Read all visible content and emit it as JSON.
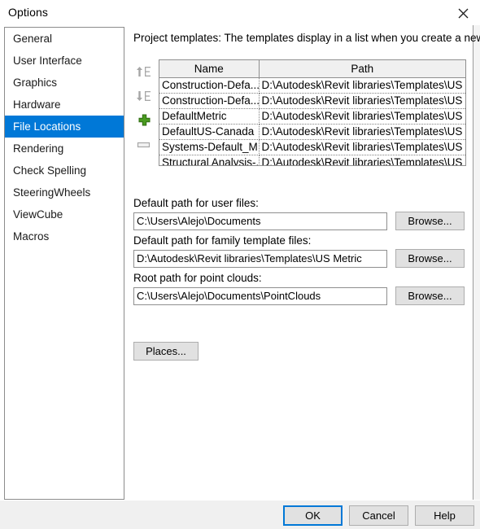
{
  "window": {
    "title": "Options",
    "close_icon": "close-icon"
  },
  "accent_color": "#0078d7",
  "sidebar": {
    "items": [
      {
        "label": "General",
        "selected": false
      },
      {
        "label": "User Interface",
        "selected": false
      },
      {
        "label": "Graphics",
        "selected": false
      },
      {
        "label": "Hardware",
        "selected": false
      },
      {
        "label": "File Locations",
        "selected": true
      },
      {
        "label": "Rendering",
        "selected": false
      },
      {
        "label": "Check Spelling",
        "selected": false
      },
      {
        "label": "SteeringWheels",
        "selected": false
      },
      {
        "label": "ViewCube",
        "selected": false
      },
      {
        "label": "Macros",
        "selected": false
      }
    ]
  },
  "content": {
    "templates_label": "Project templates:  The templates display in a list when you create a new project.",
    "list_toolbar": [
      {
        "name": "move-up-icon",
        "tooltip": "Move Up"
      },
      {
        "name": "move-down-icon",
        "tooltip": "Move Down"
      },
      {
        "name": "add-icon",
        "tooltip": "Add Value"
      },
      {
        "name": "remove-icon",
        "tooltip": "Remove Value"
      }
    ],
    "table": {
      "columns": [
        "Name",
        "Path"
      ],
      "rows": [
        {
          "name": "Construction-Defa...",
          "path": "D:\\Autodesk\\Revit libraries\\Templates\\US ..."
        },
        {
          "name": "Construction-Defa...",
          "path": "D:\\Autodesk\\Revit libraries\\Templates\\US ..."
        },
        {
          "name": "DefaultMetric",
          "path": "D:\\Autodesk\\Revit libraries\\Templates\\US ..."
        },
        {
          "name": "DefaultUS-Canada",
          "path": "D:\\Autodesk\\Revit libraries\\Templates\\US ..."
        },
        {
          "name": "Systems-Default_M...",
          "path": "D:\\Autodesk\\Revit libraries\\Templates\\US ..."
        },
        {
          "name": "Structural Analysis-...",
          "path": "D:\\Autodesk\\Revit libraries\\Templates\\US ..."
        }
      ]
    },
    "fields": [
      {
        "label": "Default path for user files:",
        "value": "C:\\Users\\Alejo\\Documents",
        "placeholder": "",
        "button": "Browse..."
      },
      {
        "label": "Default path for family template files:",
        "value": "D:\\Autodesk\\Revit libraries\\Templates\\US Metric",
        "placeholder": "",
        "button": "Browse..."
      },
      {
        "label": "Root path for point clouds:",
        "value": "C:\\Users\\Alejo\\Documents\\PointClouds",
        "placeholder": "",
        "button": "Browse..."
      }
    ],
    "places_button": "Places..."
  },
  "footer": {
    "ok": "OK",
    "cancel": "Cancel",
    "help": "Help"
  }
}
